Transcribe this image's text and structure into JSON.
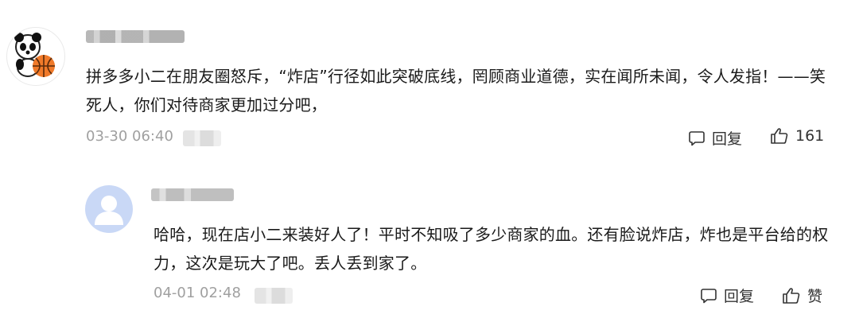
{
  "comments": [
    {
      "author_icon": "panda-basketball-avatar",
      "text": "拼多多小二在朋友圈怒斥，“炸店”行径如此突破底线，罔顾商业道德，实在闻所未闻，令人发指！——笑死人，你们对待商家更加过分吧，",
      "time": "03-30 06:40",
      "reply_label": "回复",
      "like_label": "161"
    },
    {
      "author_icon": "default-user-avatar",
      "text": "哈哈，现在店小二来装好人了！平时不知吸了多少商家的血。还有脸说炸店，炸也是平台给的权力，这次是玩大了吧。丢人丢到家了。",
      "time": "04-01 02:48",
      "reply_label": "回复",
      "like_label": "赞"
    }
  ],
  "colors": {
    "meta": "#a0a0a0",
    "avatar_bg": "#c9d8f6"
  }
}
